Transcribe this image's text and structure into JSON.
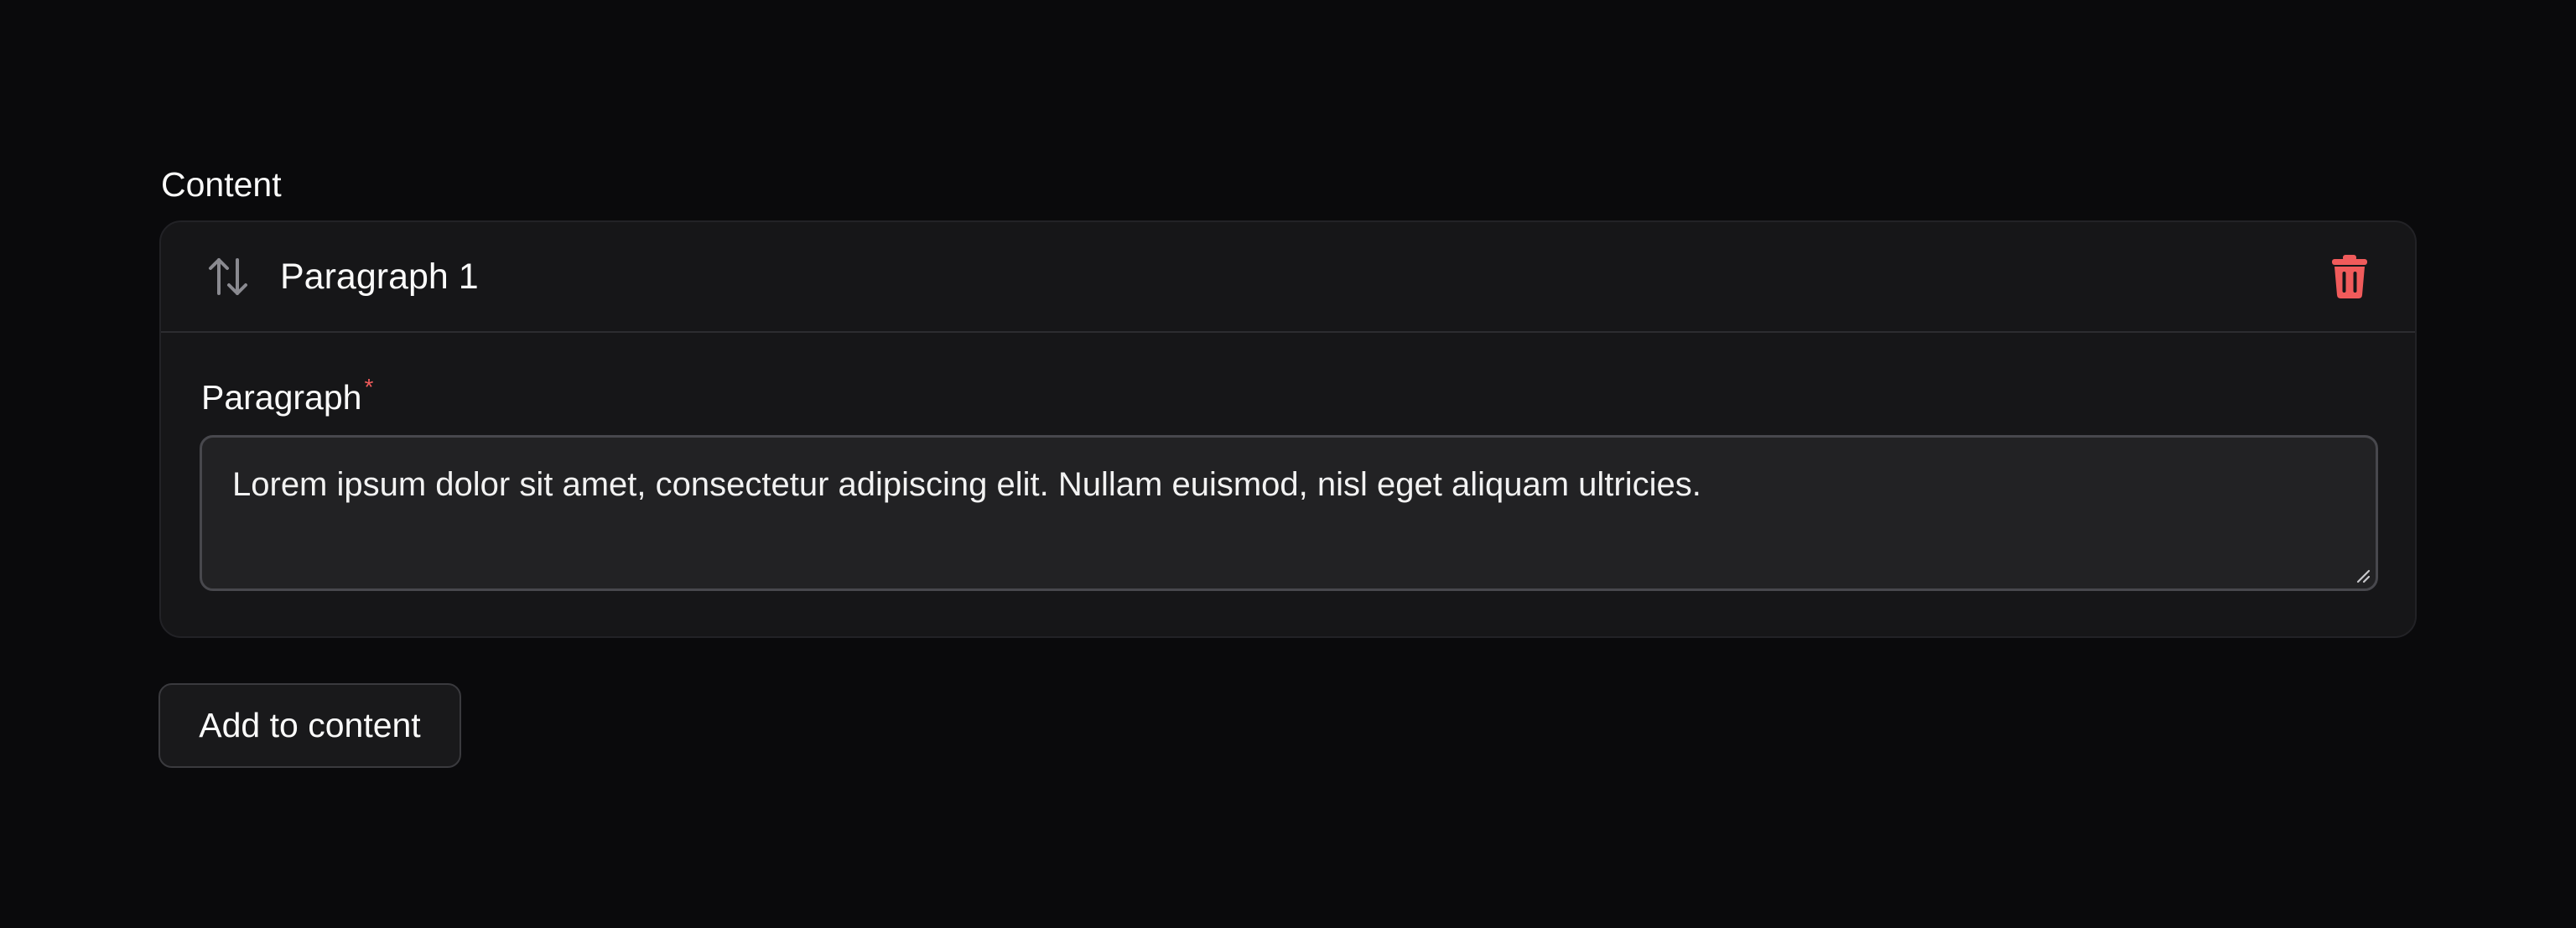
{
  "section": {
    "label": "Content"
  },
  "block": {
    "title": "Paragraph 1",
    "field_label": "Paragraph",
    "required_marker": "*",
    "value": "Lorem ipsum dolor sit amet, consectetur adipiscing elit. Nullam euismod, nisl eget aliquam ultricies.",
    "icons": {
      "drag": "arrows-up-down-icon",
      "delete": "trash-icon"
    },
    "colors": {
      "delete": "#f05b5b",
      "required": "#f05b5b",
      "drag": "#8a8a90"
    }
  },
  "actions": {
    "add_label": "Add to content"
  }
}
